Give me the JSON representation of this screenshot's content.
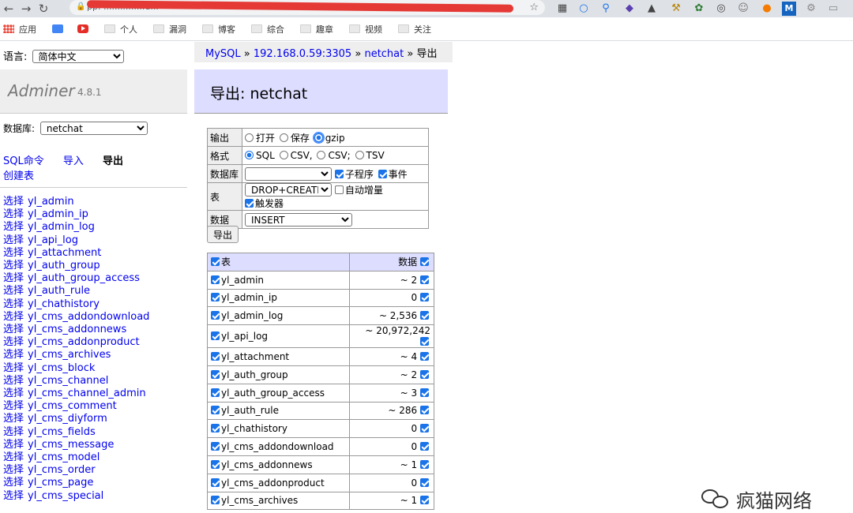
{
  "browser": {
    "url_visible": "pp. ...............d...",
    "bookmarks": [
      "应用",
      "个人",
      "漏洞",
      "博客",
      "综合",
      "趣章",
      "视频",
      "关注"
    ]
  },
  "language": {
    "label": "语言:",
    "selected": "简体中文"
  },
  "brand": {
    "name": "Adminer",
    "version": "4.8.1"
  },
  "database": {
    "label": "数据库:",
    "selected": "netchat"
  },
  "nav": {
    "sql": "SQL命令",
    "import": "导入",
    "export": "导出",
    "create_table": "创建表"
  },
  "select_label": "选择",
  "sidebar_tables": [
    "yl_admin",
    "yl_admin_ip",
    "yl_admin_log",
    "yl_api_log",
    "yl_attachment",
    "yl_auth_group",
    "yl_auth_group_access",
    "yl_auth_rule",
    "yl_chathistory",
    "yl_cms_addondownload",
    "yl_cms_addonnews",
    "yl_cms_addonproduct",
    "yl_cms_archives",
    "yl_cms_block",
    "yl_cms_channel",
    "yl_cms_channel_admin",
    "yl_cms_comment",
    "yl_cms_diyform",
    "yl_cms_fields",
    "yl_cms_message",
    "yl_cms_model",
    "yl_cms_order",
    "yl_cms_page",
    "yl_cms_special"
  ],
  "breadcrumb": {
    "mysql": "MySQL",
    "sep": "»",
    "server": "192.168.0.59:3305",
    "db": "netchat",
    "current": "导出"
  },
  "page_title": "导出: netchat",
  "options": {
    "output": {
      "label": "输出",
      "choices": [
        "打开",
        "保存",
        "gzip"
      ],
      "selected": "gzip"
    },
    "format": {
      "label": "格式",
      "choices": [
        "SQL",
        "CSV,",
        "CSV;",
        "TSV"
      ],
      "selected": "SQL"
    },
    "database": {
      "label": "数据库",
      "selected": "",
      "routines": "子程序",
      "events": "事件"
    },
    "table": {
      "label": "表",
      "selected": "DROP+CREATE",
      "auto_increment": "自动增量",
      "triggers": "触发器"
    },
    "data": {
      "label": "数据",
      "selected": "INSERT"
    }
  },
  "export_button": "导出",
  "table_list": {
    "header_table": "表",
    "header_data": "数据",
    "rows": [
      {
        "name": "yl_admin",
        "count": "~ 2"
      },
      {
        "name": "yl_admin_ip",
        "count": "0"
      },
      {
        "name": "yl_admin_log",
        "count": "~ 2,536"
      },
      {
        "name": "yl_api_log",
        "count": "~ 20,972,242"
      },
      {
        "name": "yl_attachment",
        "count": "~ 4"
      },
      {
        "name": "yl_auth_group",
        "count": "~ 2"
      },
      {
        "name": "yl_auth_group_access",
        "count": "~ 3"
      },
      {
        "name": "yl_auth_rule",
        "count": "~ 286"
      },
      {
        "name": "yl_chathistory",
        "count": "0"
      },
      {
        "name": "yl_cms_addondownload",
        "count": "0"
      },
      {
        "name": "yl_cms_addonnews",
        "count": "~ 1"
      },
      {
        "name": "yl_cms_addonproduct",
        "count": "0"
      },
      {
        "name": "yl_cms_archives",
        "count": "~ 1"
      }
    ]
  },
  "watermark": "疯猫网络"
}
